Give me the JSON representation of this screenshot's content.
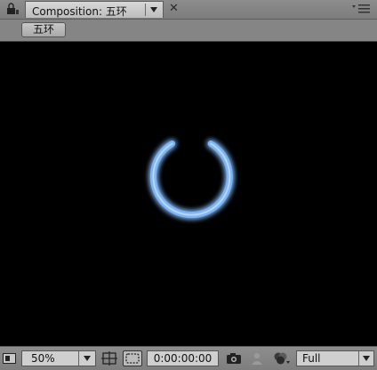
{
  "panel": {
    "tab_label": "Composition: 五环",
    "icons": {
      "lock": "lock-icon",
      "dropdown": "chevron-down-icon",
      "close": "close-icon",
      "menu": "panel-menu-icon"
    }
  },
  "breadcrumb": {
    "comp_name": "五环"
  },
  "viewer": {
    "background": "#000000",
    "ring_color": "#7fb4f5"
  },
  "toolbar": {
    "zoom": "50%",
    "timecode": "0:00:00:00",
    "resolution": "Full",
    "icons": {
      "region": "region-of-interest-icon",
      "grid": "grid-guides-icon",
      "mask": "mask-visibility-icon",
      "snapshot": "camera-icon",
      "color": "color-channel-icon",
      "channels": "show-channel-icon"
    }
  }
}
